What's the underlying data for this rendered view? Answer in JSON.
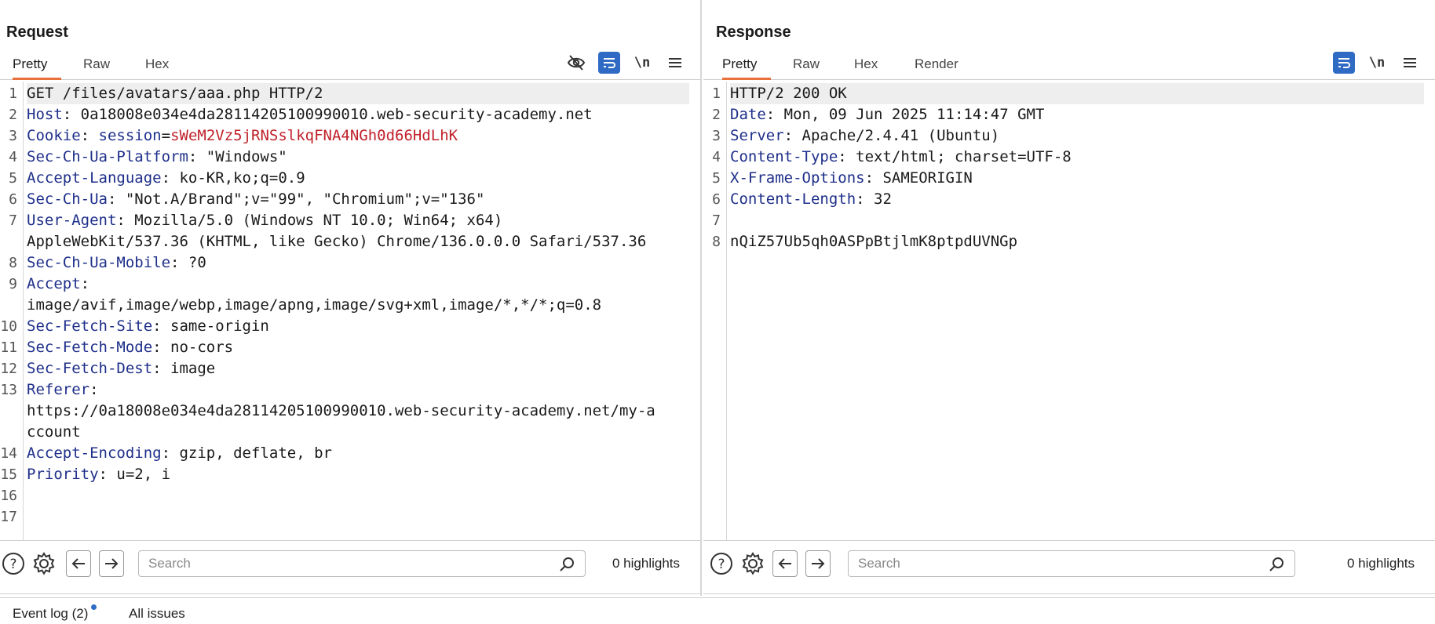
{
  "request": {
    "title": "Request",
    "tabs": [
      "Pretty",
      "Raw",
      "Hex"
    ],
    "lines": [
      {
        "n": "1",
        "name": "",
        "sep": "",
        "val": "GET /files/avatars/aaa.php HTTP/2",
        "hl": true
      },
      {
        "n": "2",
        "name": "Host",
        "sep": ": ",
        "val": "0a18008e034e4da28114205100990010.web-security-academy.net"
      },
      {
        "n": "3",
        "name": "Cookie",
        "sep": ": ",
        "cookie_name": "session",
        "cookie_eq": "=",
        "cookie_val": "sWeM2Vz5jRNSslkqFNA4NGh0d66HdLhK"
      },
      {
        "n": "4",
        "name": "Sec-Ch-Ua-Platform",
        "sep": ": ",
        "val": "\"Windows\""
      },
      {
        "n": "5",
        "name": "Accept-Language",
        "sep": ": ",
        "val": "ko-KR,ko;q=0.9"
      },
      {
        "n": "6",
        "name": "Sec-Ch-Ua",
        "sep": ": ",
        "val": "\"Not.A/Brand\";v=\"99\", \"Chromium\";v=\"136\""
      },
      {
        "n": "7",
        "name": "User-Agent",
        "sep": ": ",
        "val": "Mozilla/5.0 (Windows NT 10.0; Win64; x64)"
      },
      {
        "n": "",
        "name": "",
        "sep": "",
        "val": "AppleWebKit/537.36 (KHTML, like Gecko) Chrome/136.0.0.0 Safari/537.36"
      },
      {
        "n": "8",
        "name": "Sec-Ch-Ua-Mobile",
        "sep": ": ",
        "val": "?0"
      },
      {
        "n": "9",
        "name": "Accept",
        "sep": ":",
        "val": ""
      },
      {
        "n": "",
        "name": "",
        "sep": "",
        "val": "image/avif,image/webp,image/apng,image/svg+xml,image/*,*/*;q=0.8"
      },
      {
        "n": "10",
        "name": "Sec-Fetch-Site",
        "sep": ": ",
        "val": "same-origin"
      },
      {
        "n": "11",
        "name": "Sec-Fetch-Mode",
        "sep": ": ",
        "val": "no-cors"
      },
      {
        "n": "12",
        "name": "Sec-Fetch-Dest",
        "sep": ": ",
        "val": "image"
      },
      {
        "n": "13",
        "name": "Referer",
        "sep": ":",
        "val": ""
      },
      {
        "n": "",
        "name": "",
        "sep": "",
        "val": "https://0a18008e034e4da28114205100990010.web-security-academy.net/my-a"
      },
      {
        "n": "",
        "name": "",
        "sep": "",
        "val": "ccount"
      },
      {
        "n": "14",
        "name": "Accept-Encoding",
        "sep": ": ",
        "val": "gzip, deflate, br"
      },
      {
        "n": "15",
        "name": "Priority",
        "sep": ": ",
        "val": "u=2, i"
      },
      {
        "n": "16",
        "name": "",
        "sep": "",
        "val": ""
      },
      {
        "n": "17",
        "name": "",
        "sep": "",
        "val": ""
      }
    ],
    "search_placeholder": "Search",
    "highlights": "0 highlights"
  },
  "response": {
    "title": "Response",
    "tabs": [
      "Pretty",
      "Raw",
      "Hex",
      "Render"
    ],
    "lines": [
      {
        "n": "1",
        "name": "",
        "sep": "",
        "val": "HTTP/2 200 OK",
        "hl": true
      },
      {
        "n": "2",
        "name": "Date",
        "sep": ": ",
        "val": "Mon, 09 Jun 2025 11:14:47 GMT"
      },
      {
        "n": "3",
        "name": "Server",
        "sep": ": ",
        "val": "Apache/2.4.41 (Ubuntu)"
      },
      {
        "n": "4",
        "name": "Content-Type",
        "sep": ": ",
        "val": "text/html; charset=UTF-8"
      },
      {
        "n": "5",
        "name": "X-Frame-Options",
        "sep": ": ",
        "val": "SAMEORIGIN"
      },
      {
        "n": "6",
        "name": "Content-Length",
        "sep": ": ",
        "val": "32"
      },
      {
        "n": "7",
        "name": "",
        "sep": "",
        "val": ""
      },
      {
        "n": "8",
        "name": "",
        "sep": "",
        "val": "nQiZ57Ub5qh0ASPpBtjlmK8ptpdUVNGp"
      }
    ],
    "search_placeholder": "Search",
    "highlights": "0 highlights"
  },
  "toolbar": {
    "newline_label": "\\n"
  },
  "footer": {
    "event_log": "Event log (2)",
    "all_issues": "All issues"
  },
  "icons": {
    "hide": "eye-slash-icon",
    "wrap": "word-wrap-icon",
    "menu": "hamburger-menu-icon",
    "help": "help-icon",
    "settings": "gear-icon",
    "back": "arrow-left-icon",
    "forward": "arrow-right-icon",
    "search": "search-icon"
  },
  "colors": {
    "accent": "#2f6bc4",
    "tab_active": "#e8713a",
    "header_name": "#1e2f8a",
    "cookie": "#c0212a"
  }
}
